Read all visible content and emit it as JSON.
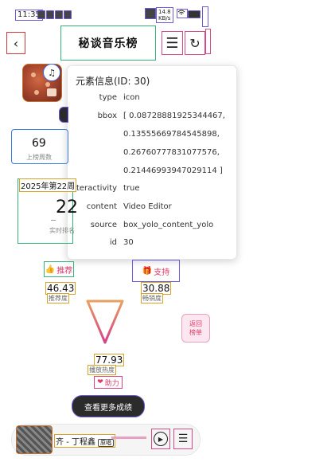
{
  "domain": "Computer-Use",
  "status_bar": {
    "time": "11:35",
    "network_speed_top": "14.8",
    "network_speed_bottom": "KB/s"
  },
  "header": {
    "title": "秘谈音乐榜",
    "back_icon": "chevron-left-icon",
    "menu_icon": "menu-icon",
    "refresh_icon": "refresh-icon"
  },
  "tooltip": {
    "title": "元素信息(ID: 30)",
    "rows": [
      {
        "key": "type",
        "value": "icon"
      },
      {
        "key": "bbox",
        "value": "[ 0.08728881925344467,"
      },
      {
        "key": "",
        "value": "0.13555669784545898,"
      },
      {
        "key": "",
        "value": "0.26760777831077576,"
      },
      {
        "key": "",
        "value": "0.21446993947029114 ]"
      },
      {
        "key": "interactivity",
        "value": "true"
      },
      {
        "key": "content",
        "value": "Video Editor"
      },
      {
        "key": "source",
        "value": "box_yolo_content_yolo"
      },
      {
        "key": "id",
        "value": "30"
      }
    ]
  },
  "stats": {
    "count_value": "69",
    "count_label": "上榜周数",
    "week_label": "2025年第22周",
    "week_number": "22",
    "week_sub": "实时排名"
  },
  "tabs": {
    "recommend": "推荐",
    "support": "支持"
  },
  "metrics": {
    "recommend_value": "46.43",
    "recommend_label": "推荐度",
    "support_value": "30.88",
    "support_label": "畅销度"
  },
  "rank_button": {
    "line1": "返回",
    "line2": "榜单"
  },
  "boost": {
    "value": "77.93",
    "label": "播放热度",
    "button": "助力"
  },
  "view_more": "查看更多成绩",
  "player": {
    "title": "齐 - 丁程鑫",
    "tag": "原唱"
  },
  "colors": {
    "accent": "#e23b6a",
    "triangle_top": "#e8a060",
    "triangle_bottom": "#d6408a"
  }
}
